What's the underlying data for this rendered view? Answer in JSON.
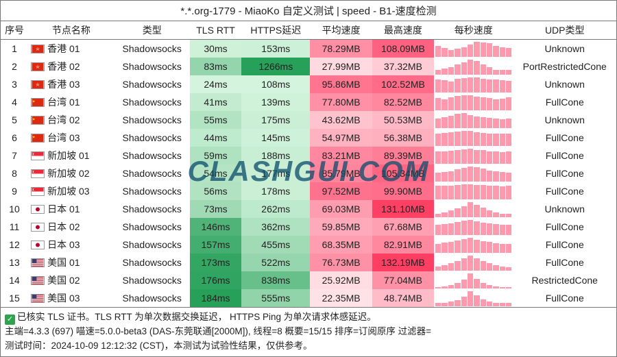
{
  "title": "*.*.org-1779 - MiaoKo 自定义测试 | speed - B1-速度检测",
  "watermark": "CLASHGUI.COM",
  "headers": {
    "idx": "序号",
    "node": "节点名称",
    "type": "类型",
    "tls": "TLS RTT",
    "https": "HTTPS延迟",
    "avg": "平均速度",
    "max": "最高速度",
    "persec": "每秒速度",
    "udp": "UDP类型"
  },
  "rows": [
    {
      "idx": 1,
      "flag": "hk",
      "node": "香港 01",
      "type": "Shadowsocks",
      "tls": "30ms",
      "https": "153ms",
      "avg": "78.29MB",
      "max": "108.09MB",
      "udp": "Unknown",
      "persec": [
        70,
        55,
        45,
        50,
        62,
        80,
        95,
        90,
        85,
        70,
        60,
        55
      ]
    },
    {
      "idx": 2,
      "flag": "hk",
      "node": "香港 02",
      "type": "Shadowsocks",
      "tls": "83ms",
      "https": "1266ms",
      "avg": "27.99MB",
      "max": "37.32MB",
      "udp": "PortRestrictedCone",
      "persec": [
        10,
        12,
        15,
        20,
        25,
        30,
        28,
        20,
        15,
        10,
        10,
        10
      ]
    },
    {
      "idx": 3,
      "flag": "hk",
      "node": "香港 03",
      "type": "Shadowsocks",
      "tls": "24ms",
      "https": "108ms",
      "avg": "95.86MB",
      "max": "102.52MB",
      "udp": "Unknown",
      "persec": [
        85,
        80,
        75,
        90,
        95,
        100,
        98,
        92,
        88,
        85,
        80,
        78
      ]
    },
    {
      "idx": 4,
      "flag": "cn",
      "node": "台湾 01",
      "type": "Shadowsocks",
      "tls": "41ms",
      "https": "139ms",
      "avg": "77.80MB",
      "max": "82.52MB",
      "udp": "FullCone",
      "persec": [
        65,
        60,
        70,
        75,
        80,
        78,
        72,
        68,
        65,
        60,
        62,
        70
      ]
    },
    {
      "idx": 5,
      "flag": "cn",
      "node": "台湾 02",
      "type": "Shadowsocks",
      "tls": "55ms",
      "https": "175ms",
      "avg": "43.62MB",
      "max": "50.53MB",
      "udp": "Unknown",
      "persec": [
        30,
        35,
        40,
        45,
        48,
        42,
        38,
        35,
        32,
        30,
        28,
        30
      ]
    },
    {
      "idx": 6,
      "flag": "cn",
      "node": "台湾 03",
      "type": "Shadowsocks",
      "tls": "44ms",
      "https": "145ms",
      "avg": "54.97MB",
      "max": "56.38MB",
      "udp": "FullCone",
      "persec": [
        45,
        48,
        50,
        52,
        55,
        54,
        50,
        48,
        46,
        45,
        44,
        46
      ]
    },
    {
      "idx": 7,
      "flag": "sg",
      "node": "新加坡 01",
      "type": "Shadowsocks",
      "tls": "59ms",
      "https": "188ms",
      "avg": "83.21MB",
      "max": "89.39MB",
      "udp": "FullCone",
      "persec": [
        70,
        72,
        75,
        80,
        85,
        88,
        82,
        78,
        74,
        70,
        68,
        70
      ]
    },
    {
      "idx": 8,
      "flag": "sg",
      "node": "新加坡 02",
      "type": "Shadowsocks",
      "tls": "54ms",
      "https": "177ms",
      "avg": "85.79MB",
      "max": "105.34MB",
      "udp": "FullCone",
      "persec": [
        60,
        65,
        70,
        80,
        90,
        100,
        95,
        85,
        75,
        70,
        65,
        60
      ]
    },
    {
      "idx": 9,
      "flag": "sg",
      "node": "新加坡 03",
      "type": "Shadowsocks",
      "tls": "56ms",
      "https": "178ms",
      "avg": "97.52MB",
      "max": "99.90MB",
      "udp": "FullCone",
      "persec": [
        90,
        88,
        92,
        95,
        98,
        99,
        96,
        93,
        90,
        88,
        86,
        88
      ]
    },
    {
      "idx": 10,
      "flag": "jp",
      "node": "日本 01",
      "type": "Shadowsocks",
      "tls": "73ms",
      "https": "262ms",
      "avg": "69.03MB",
      "max": "131.10MB",
      "udp": "Unknown",
      "persec": [
        30,
        40,
        55,
        70,
        90,
        120,
        100,
        75,
        55,
        40,
        30,
        25
      ]
    },
    {
      "idx": 11,
      "flag": "jp",
      "node": "日本 02",
      "type": "Shadowsocks",
      "tls": "146ms",
      "https": "362ms",
      "avg": "59.85MB",
      "max": "67.68MB",
      "udp": "FullCone",
      "persec": [
        45,
        48,
        52,
        58,
        62,
        66,
        60,
        55,
        50,
        48,
        46,
        45
      ]
    },
    {
      "idx": 12,
      "flag": "jp",
      "node": "日本 03",
      "type": "Shadowsocks",
      "tls": "157ms",
      "https": "455ms",
      "avg": "68.35MB",
      "max": "82.91MB",
      "udp": "FullCone",
      "persec": [
        50,
        55,
        60,
        68,
        75,
        82,
        72,
        64,
        58,
        52,
        48,
        50
      ]
    },
    {
      "idx": 13,
      "flag": "us",
      "node": "美国 01",
      "type": "Shadowsocks",
      "tls": "173ms",
      "https": "522ms",
      "avg": "76.73MB",
      "max": "132.19MB",
      "udp": "FullCone",
      "persec": [
        35,
        45,
        60,
        80,
        100,
        125,
        105,
        80,
        60,
        45,
        35,
        30
      ]
    },
    {
      "idx": 14,
      "flag": "us",
      "node": "美国 02",
      "type": "Shadowsocks",
      "tls": "176ms",
      "https": "838ms",
      "avg": "25.92MB",
      "max": "77.04MB",
      "udp": "RestrictedCone",
      "persec": [
        8,
        10,
        15,
        25,
        40,
        70,
        45,
        25,
        15,
        10,
        8,
        8
      ]
    },
    {
      "idx": 15,
      "flag": "us",
      "node": "美国 03",
      "type": "Shadowsocks",
      "tls": "184ms",
      "https": "555ms",
      "avg": "22.35MB",
      "max": "48.74MB",
      "udp": "FullCone",
      "persec": [
        10,
        12,
        15,
        20,
        30,
        48,
        35,
        22,
        16,
        12,
        10,
        10
      ]
    }
  ],
  "footer": {
    "line1a": "已核实 TLS 证书。TLS RTT 为单次数据交换延迟，",
    "line1b": " HTTPS Ping 为单次请求体感延迟。",
    "line2": "主端=4.3.3 (697) 喵速=5.0.0-beta3 (DAS-东莞联通[2000M]), 线程=8 概要=15/15 排序=订阅原序 过滤器=",
    "line3": "测试时间：2024-10-09 12:12:32 (CST)，本测试为试验性结果，仅供参考。"
  },
  "scales": {
    "tls": {
      "min": 24,
      "max": 184
    },
    "https": {
      "min": 108,
      "max": 1266
    },
    "speed": {
      "min": 22,
      "max": 133
    }
  }
}
